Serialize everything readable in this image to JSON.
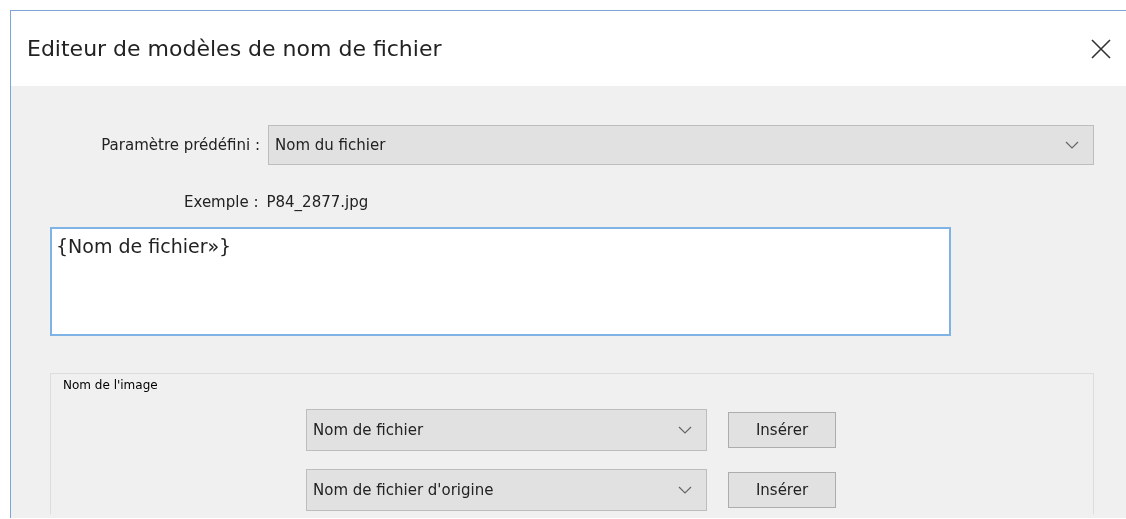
{
  "window": {
    "title": "Editeur de modèles de nom de fichier"
  },
  "preset": {
    "label": "Paramètre prédéfini :",
    "value": "Nom du fichier"
  },
  "example": {
    "label": "Exemple :",
    "value": "P84_2877.jpg"
  },
  "template": {
    "value": "{Nom de fichier»}"
  },
  "image_name_group": {
    "title": "Nom de l'image",
    "rows": [
      {
        "value": "Nom de fichier",
        "button": "Insérer"
      },
      {
        "value": "Nom de fichier d'origine",
        "button": "Insérer"
      }
    ]
  }
}
